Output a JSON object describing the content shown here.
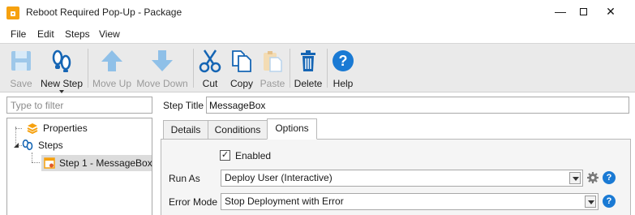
{
  "window": {
    "title": "Reboot Required Pop-Up - Package",
    "minimize_glyph": "—",
    "close_glyph": "✕"
  },
  "menu": {
    "file": "File",
    "edit": "Edit",
    "steps": "Steps",
    "view": "View"
  },
  "toolbar": {
    "save": "Save",
    "new_step": "New Step",
    "move_up": "Move Up",
    "move_down": "Move Down",
    "cut": "Cut",
    "copy": "Copy",
    "paste": "Paste",
    "delete": "Delete",
    "help": "Help"
  },
  "left": {
    "filter_placeholder": "Type to filter",
    "tree": {
      "properties": "Properties",
      "steps": "Steps",
      "step1": "Step 1 - MessageBox"
    }
  },
  "right": {
    "step_title_label": "Step Title",
    "step_title_value": "MessageBox",
    "tabs": {
      "details": "Details",
      "conditions": "Conditions",
      "options": "Options"
    },
    "enabled_label": "Enabled",
    "enabled_check": "✓",
    "run_as_label": "Run As",
    "run_as_value": "Deploy User (Interactive)",
    "error_mode_label": "Error Mode",
    "error_mode_value": "Stop Deployment with Error",
    "help_glyph": "?"
  },
  "colors": {
    "accent": "#1a7ad4",
    "brand": "#f6a10f",
    "toolbar_bg": "#eaeaea",
    "disabled_icon": "#8fc0e8"
  }
}
